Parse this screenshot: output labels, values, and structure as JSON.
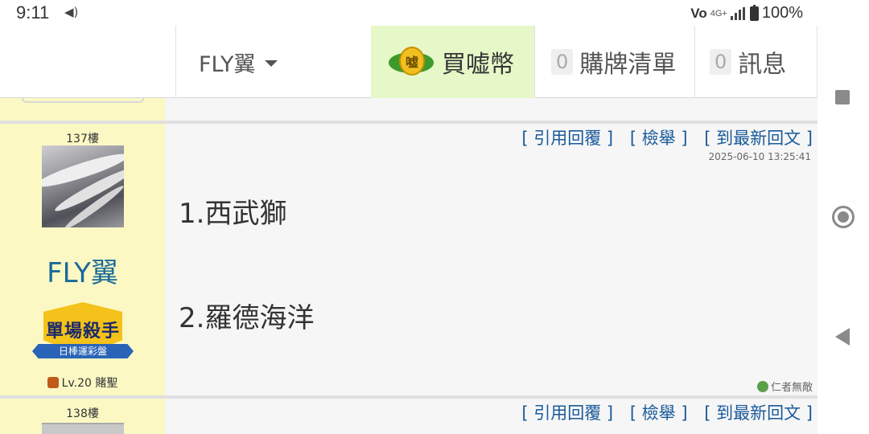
{
  "statusbar": {
    "time": "9:11",
    "battery": "100%",
    "network": "4G+",
    "volte": "Vo"
  },
  "header": {
    "username": "FLY翼",
    "buy": {
      "label": "買嘘幣",
      "coin_glyph": "嘘"
    },
    "cart": {
      "count": "0",
      "label": "購牌清單"
    },
    "messages": {
      "count": "0",
      "label": "訊息"
    }
  },
  "posts": [
    {
      "floor": "137樓",
      "username": "FLY翼",
      "badge_title": "單場殺手",
      "badge_subtitle": "日棒運彩盤",
      "level": "Lv.20 賭聖",
      "actions": {
        "quote": "[ 引用回覆 ]",
        "report": "[ 檢舉 ]",
        "latest": "[ 到最新回文 ]"
      },
      "timestamp": "2025-06-10 13:25:41",
      "lines": [
        "1.西武獅",
        "2.羅德海洋"
      ],
      "signature": "仁者無敵"
    },
    {
      "floor": "138樓",
      "actions": {
        "quote": "[ 引用回覆 ]",
        "report": "[ 檢舉 ]",
        "latest": "[ 到最新回文 ]"
      }
    }
  ],
  "colors": {
    "sidebar_bg": "#fbf8c4",
    "post_bg": "#f6f6f6",
    "buy_bg": "#e6f7c8",
    "link": "#1a5a9a",
    "username": "#1a6a9a"
  },
  "icons": {
    "volume": "volume-icon",
    "signal": "signal-icon",
    "battery": "battery-icon",
    "coin": "coin-icon",
    "caret": "caret-down-icon",
    "recents": "recents-icon",
    "home": "home-icon",
    "back": "back-icon"
  }
}
